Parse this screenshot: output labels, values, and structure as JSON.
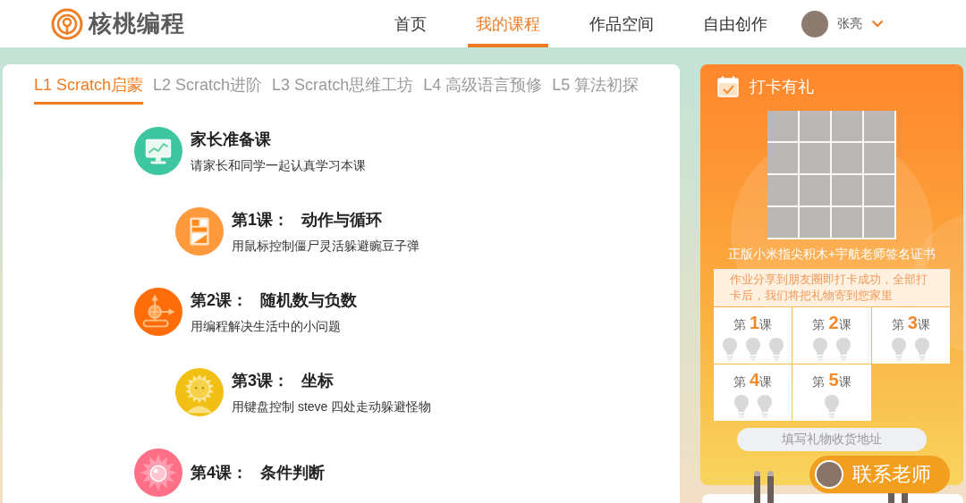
{
  "header": {
    "logo": "核桃编程",
    "nav": [
      {
        "label": "首页",
        "selected": false
      },
      {
        "label": "我的课程",
        "selected": true
      },
      {
        "label": "作品空间",
        "selected": false
      },
      {
        "label": "自由创作",
        "selected": false
      }
    ],
    "user": {
      "name": "张亮"
    }
  },
  "course_tabs": [
    {
      "label": "L1 Scratch启蒙",
      "selected": true
    },
    {
      "label": "L2 Scratch进阶",
      "selected": false
    },
    {
      "label": "L3 Scratch思维工坊",
      "selected": false
    },
    {
      "label": "L4 高级语言预修",
      "selected": false
    },
    {
      "label": "L5 算法初探",
      "selected": false
    }
  ],
  "lessons": [
    {
      "kind": "monitor",
      "color": "#3ec6a0",
      "title": "家长准备课",
      "description": "请家长和同学一起认真学习本课"
    },
    {
      "kind": "blocks",
      "color": "#ff9a3c",
      "number": "第1课：",
      "title": "动作与循环",
      "description": "用鼠标控制僵尸灵活躲避豌豆子弹"
    },
    {
      "kind": "crosshair",
      "color": "#ff6d0a",
      "number": "第2课：",
      "title": "随机数与负数",
      "description": "用编程解决生活中的小问题"
    },
    {
      "kind": "sunflower",
      "color": "#f2c014",
      "number": "第3课：",
      "title": "坐标",
      "description": "用键盘控制 steve 四处走动躲避怪物"
    },
    {
      "kind": "starburst",
      "color": "#ff6f86",
      "number": "第4课：",
      "title": "条件判断"
    }
  ],
  "checkin": {
    "title": "打卡有礼",
    "prize": "正版小米指尖积木+宇航老师签名证书",
    "notice": "作业分享到朋友圈即打卡成功，全部打卡后，我们将把礼物寄到您家里",
    "lessons": [
      {
        "label": "第 **1**课",
        "bulbs": [
          {
            "lit": false
          },
          {
            "lit": false
          },
          {
            "lit": false
          }
        ]
      },
      {
        "label": "第 **2**课",
        "bulbs": [
          {
            "lit": false
          },
          {
            "lit": false
          }
        ]
      },
      {
        "label": "第 **3**课",
        "bulbs": [
          {
            "lit": false
          },
          {
            "lit": false
          }
        ]
      },
      {
        "label": "第 **4**课",
        "bulbs": [
          {
            "lit": false
          },
          {
            "lit": false
          }
        ]
      },
      {
        "label": "第 **5**课",
        "bulbs": [
          {
            "lit": false
          }
        ]
      }
    ],
    "address_button": {
      "label": "填写礼物收货地址"
    }
  },
  "contact_button": {
    "label": "联系老师"
  }
}
